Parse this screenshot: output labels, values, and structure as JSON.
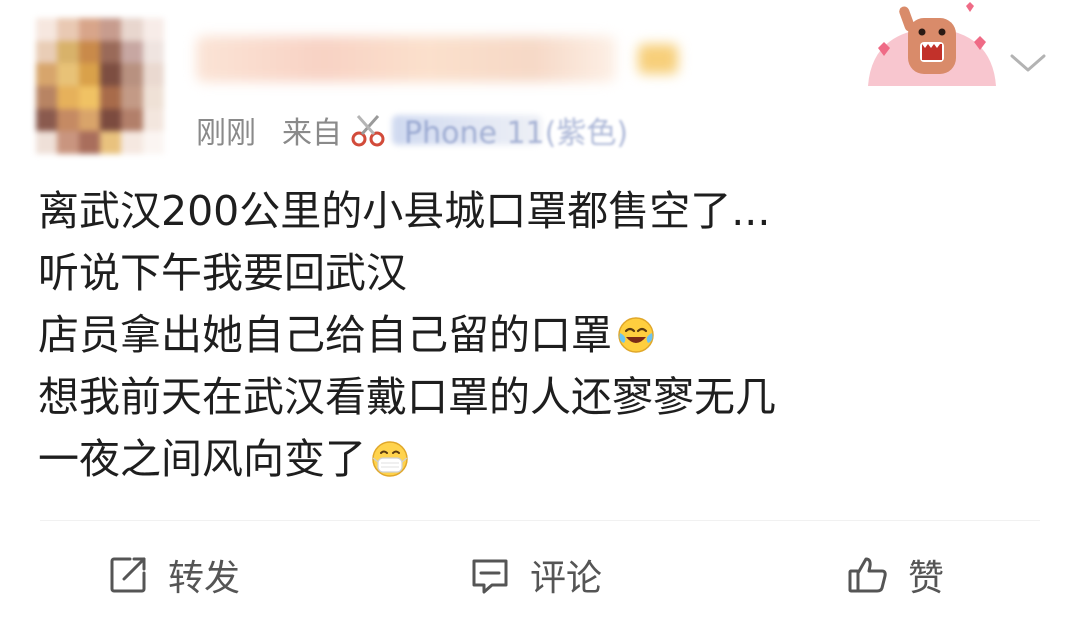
{
  "post": {
    "username": "",
    "time": "刚刚",
    "source_prefix": "来自",
    "source_device": "Phone 11(紫色)",
    "lines": [
      "离武汉200公里的小县城口罩都售空了...",
      "听说下午我要回武汉",
      "店员拿出她自己给自己留的口罩",
      "想我前天在武汉看戴口罩的人还寥寥无几",
      "一夜之间风向变了"
    ],
    "emoji_line_3": "laughing-crying-emoji",
    "emoji_line_5": "mask-face-emoji"
  },
  "actions": {
    "repost_label": "转发",
    "comment_label": "评论",
    "like_label": "赞"
  },
  "colors": {
    "text": "#1e1e1e",
    "meta": "#8a8a8a",
    "device": "#6b7fb8",
    "action": "#555555"
  }
}
